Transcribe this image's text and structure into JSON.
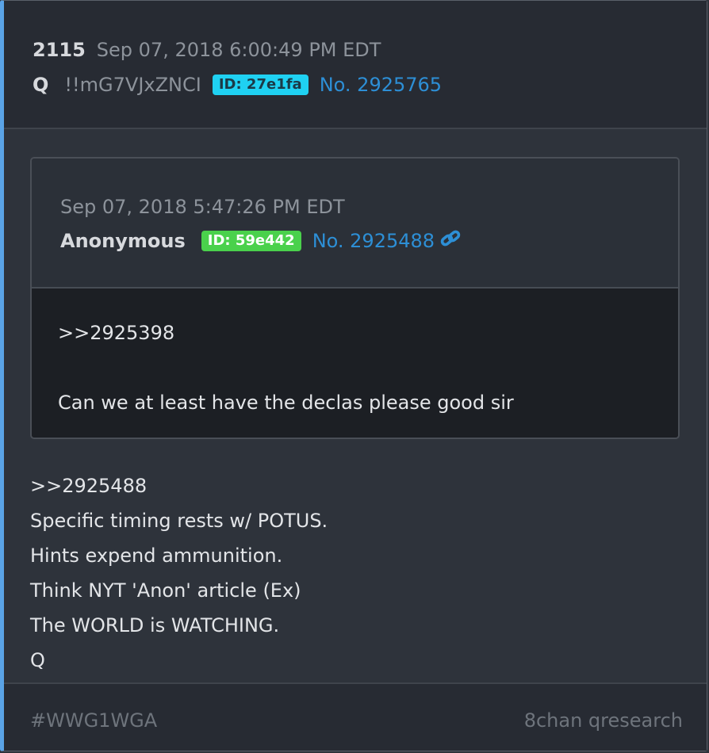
{
  "post": {
    "number": "2115",
    "timestamp": "Sep 07, 2018 6:00:49 PM EDT",
    "author": "Q",
    "tripcode": "!!mG7VJxZNCI",
    "id_badge": "ID: 27e1fa",
    "post_link": "No. 2925765",
    "colors": {
      "left_accent": "#5aa3e6",
      "id_badge_bg": "#1fd1f2",
      "link": "#2d8fd6"
    }
  },
  "quoted": {
    "timestamp": "Sep 07, 2018 5:47:26 PM EDT",
    "author": "Anonymous",
    "id_badge": "ID: 59e442",
    "post_link": "No. 2925488",
    "link_icon": "link-icon",
    "body": [
      ">>2925398",
      "Can we at least have the declas please good sir"
    ],
    "colors": {
      "id_badge_bg": "#4ad14c"
    }
  },
  "body": [
    ">>2925488",
    "Specific timing rests w/ POTUS.",
    "Hints expend ammunition.",
    "Think NYT 'Anon' article (Ex)",
    "The WORLD is WATCHING.",
    "Q"
  ],
  "footer": {
    "tag": "#WWG1WGA",
    "source": "8chan qresearch"
  }
}
